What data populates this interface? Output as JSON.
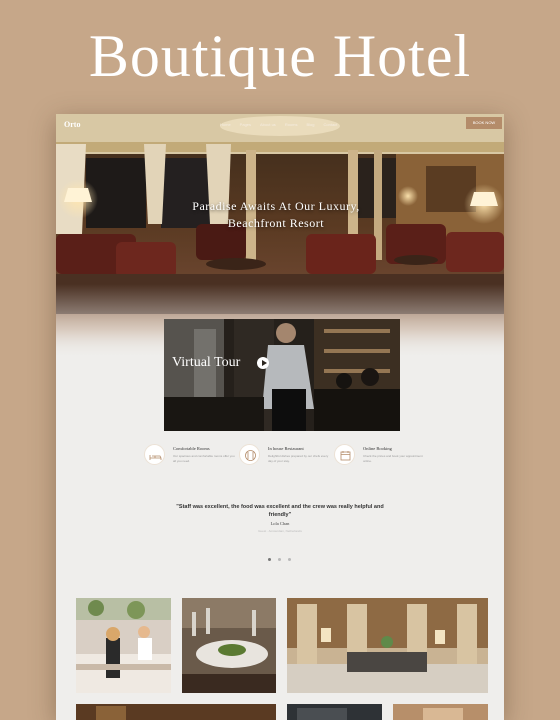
{
  "promo": {
    "title": "Boutique Hotel"
  },
  "nav": {
    "logo": "Orto",
    "links": [
      "Home",
      "Pages",
      "About us",
      "Rooms",
      "Blog",
      "Contact"
    ],
    "book_label": "BOOK NOW"
  },
  "hero": {
    "heading_line1": "Paradise Awaits At Our Luxury,",
    "heading_line2": "Beachfront Resort"
  },
  "tour": {
    "label": "Virtual Tour"
  },
  "features": [
    {
      "title": "Comfortable Rooms",
      "text": "Our spacious and comfortable rooms offer you all you need.",
      "icon": "bed-icon"
    },
    {
      "title": "In house Restaurant",
      "text": "Delightful dishes prepared by our chefs every day of your stay.",
      "icon": "restaurant-icon"
    },
    {
      "title": "Online Booking",
      "text": "Check the prices and book your appointment online.",
      "icon": "calendar-icon"
    }
  ],
  "testimonial": {
    "quote": "\"Staff was excellent, the food was excellent and the crew was really helpful and friendly\"",
    "author": "Lola Chan",
    "role": "Guest · Amsterdam, Netherlands"
  },
  "carousel": {
    "total_dots": 3,
    "active_dot": 1
  },
  "colors": {
    "accent": "#b48c6a",
    "background": "#c6a789",
    "page": "#efeeec"
  }
}
